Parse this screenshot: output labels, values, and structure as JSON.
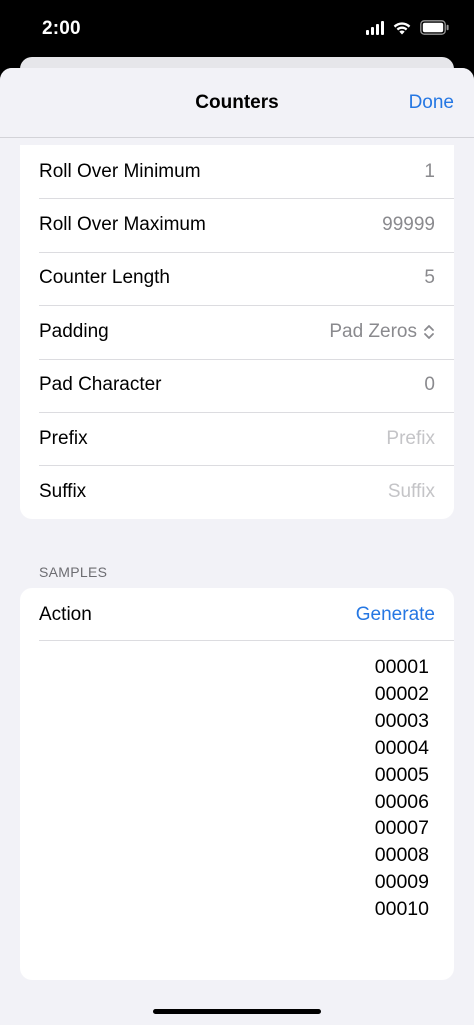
{
  "status_bar": {
    "time": "2:00"
  },
  "nav": {
    "title": "Counters",
    "done_label": "Done"
  },
  "settings": {
    "rows": [
      {
        "label": "Roll Over Minimum",
        "value": "1"
      },
      {
        "label": "Roll Over Maximum",
        "value": "99999"
      },
      {
        "label": "Counter Length",
        "value": "5"
      },
      {
        "label": "Padding",
        "value": "Pad Zeros"
      },
      {
        "label": "Pad Character",
        "value": "0"
      },
      {
        "label": "Prefix",
        "value": "",
        "placeholder": "Prefix"
      },
      {
        "label": "Suffix",
        "value": "",
        "placeholder": "Suffix"
      }
    ]
  },
  "samples": {
    "header": "SAMPLES",
    "action_label": "Action",
    "generate_label": "Generate",
    "output": [
      "00001",
      "00002",
      "00003",
      "00004",
      "00005",
      "00006",
      "00007",
      "00008",
      "00009",
      "00010"
    ]
  },
  "colors": {
    "accent": "#2577e3",
    "background": "#f2f2f7",
    "secondary_text": "#8a8a8e",
    "placeholder_text": "#c4c4c7"
  },
  "icons": {
    "signal": "cellular-signal-icon",
    "wifi": "wifi-icon",
    "battery": "battery-icon",
    "picker": "chevron-up-down-icon"
  }
}
